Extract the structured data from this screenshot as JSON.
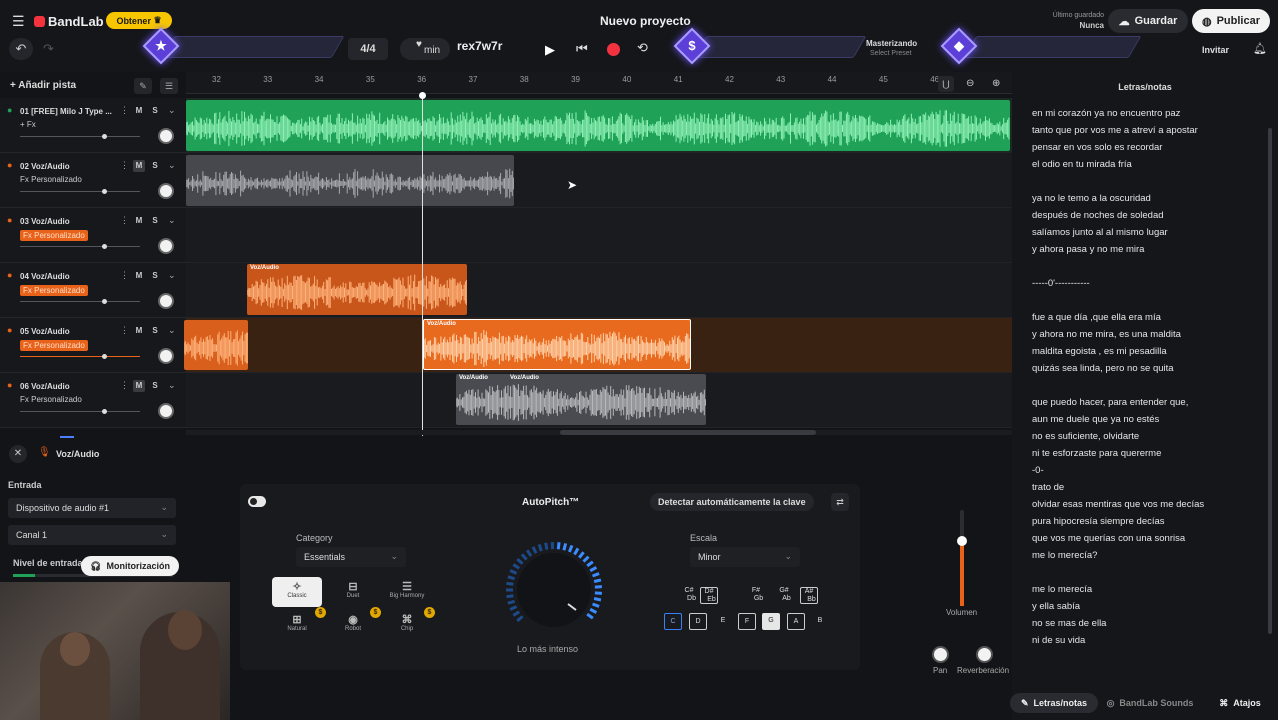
{
  "app": {
    "brand": "BandLab",
    "badge": "Obtener",
    "project_title": "Nuevo proyecto",
    "saved_label": "Último guardado",
    "saved_value": "Nunca",
    "save_button": "Guardar",
    "publish_button": "Publicar",
    "invite_button": "Invitar"
  },
  "transport": {
    "time_signature": "4/4",
    "tempo_suffix": "min",
    "key_text": "rex7w7r",
    "mastering_label": "Masterizando",
    "mastering_preset": "Select Preset"
  },
  "tracks_header": {
    "add_track": "Añadir pista"
  },
  "ruler": [
    "32",
    "33",
    "34",
    "35",
    "36",
    "37",
    "38",
    "39",
    "40",
    "41",
    "42",
    "43",
    "44",
    "45",
    "46"
  ],
  "tracks": [
    {
      "name": "01 [FREE] Milo J Type ...",
      "fx": "+ Fx",
      "fx_active": false
    },
    {
      "name": "02 Voz/Audio",
      "fx": "Fx Personalizado",
      "fx_active": false
    },
    {
      "name": "03 Voz/Audio",
      "fx": "Fx Personalizado",
      "fx_active": true
    },
    {
      "name": "04 Voz/Audio",
      "fx": "Fx Personalizado",
      "fx_active": true
    },
    {
      "name": "05 Voz/Audio",
      "fx": "Fx Personalizado",
      "fx_active": true
    },
    {
      "name": "06 Voz/Audio",
      "fx": "Fx Personalizado",
      "fx_active": false
    }
  ],
  "clips": {
    "voice": "Voz/Audio"
  },
  "inspector": {
    "track_title": "Voz/Audio",
    "input_label": "Entrada",
    "device": "Dispositivo de audio #1",
    "channel": "Canal 1",
    "input_level": "Nivel de entrada",
    "monitor_button": "Monitorización"
  },
  "autopitch": {
    "title": "AutoPitch™",
    "detect_key": "Detectar automáticamente la clave",
    "category_label": "Category",
    "category_value": "Essentials",
    "scale_label": "Escala",
    "scale_value": "Minor",
    "categories": [
      "Classic",
      "Duet",
      "Big Harmony",
      "Natural",
      "Robot",
      "Chip"
    ],
    "knob_caption": "Lo más intenso",
    "notes_top": [
      [
        "C#",
        "Db"
      ],
      [
        "D#",
        "Eb"
      ],
      [
        "F#",
        "Gb"
      ],
      [
        "G#",
        "Ab"
      ],
      [
        "A#",
        "Bb"
      ]
    ],
    "notes_bottom": [
      "C",
      "D",
      "E",
      "F",
      "G",
      "A",
      "B"
    ]
  },
  "mixer": {
    "volume": "Volumen",
    "pan": "Pan",
    "reverb": "Reverberación"
  },
  "lyrics": {
    "title": "Letras/notas",
    "lines": [
      "en mi corazón ya no encuentro paz",
      "tanto que por vos me a  atreví a apostar",
      "pensar en vos solo es recordar",
      "el odio en tu mirada fría",
      "",
      "ya no le temo a la oscuridad",
      "después de noches de soledad",
      "salíamos junto al  al  mismo lugar",
      "y ahora pasa y no me mira",
      "",
      "-----0'-----------",
      "",
      "fue a que día ,que ella era mía",
      "y ahora no me mira, es una maldita",
      "maldita egoista , es mi pesadilla",
      "quizás sea linda, pero no se quita",
      "",
      "que puedo hacer, para entender que,",
      "aun me duele que ya no estés",
      "no es suficiente, olvidarte",
      "ni te esforzaste para quererme",
      "-0-",
      "trato de",
      "olvidar esas mentiras que vos me decías",
      "pura hipocresía siempre decías",
      "que vos me querías con una sonrisa",
      "me lo merecía?",
      "",
      "me lo merecía",
      "y ella sabía",
      "no se mas de ella",
      "ni de su vida"
    ]
  },
  "bottom_tabs": [
    "Letras/notas",
    "BandLab Sounds",
    "Atajos"
  ]
}
